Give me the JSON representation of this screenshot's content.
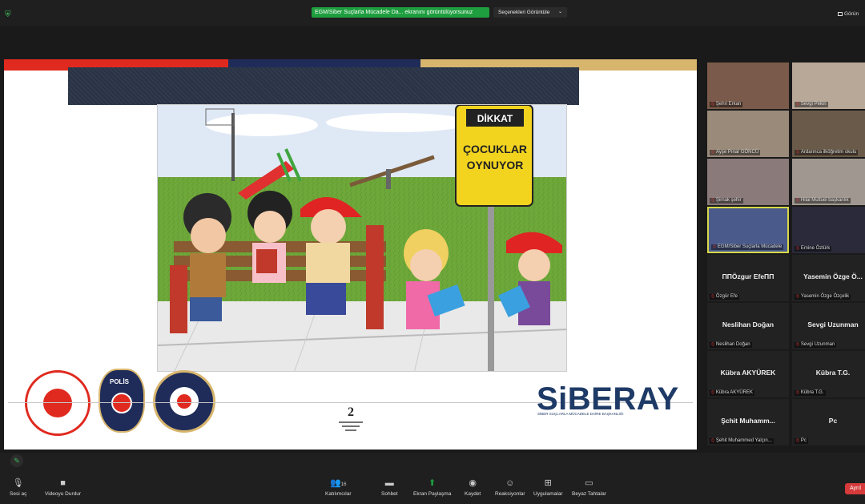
{
  "topbar": {
    "share_text": "EGM/Siber Suçlarla Mücadele Da... ekranını görüntülüyorsunuz",
    "view_options_label": "Seçenekleri Görüntüle",
    "fullscreen_label": "Görün"
  },
  "slide": {
    "page_number": "2",
    "brand": "SiBERAY",
    "brand_subtitle": "SİBER SUÇLARLA MÜCADELE DAİRE BAŞKANLIĞI",
    "sign_top": "DİKKAT",
    "sign_text": "ÇOCUKLAR OYNUYOR",
    "seal_polis": "POLİS"
  },
  "participants": [
    {
      "name": "Şehri Erkan",
      "label": ""
    },
    {
      "name": "Sevgi Pekin",
      "label": ""
    },
    {
      "name": "Ayşe Pınar GÖNCÜ",
      "label": ""
    },
    {
      "name": "Ardarınca ilköğretim okulu",
      "label": ""
    },
    {
      "name": "Şirnak şehir",
      "label": ""
    },
    {
      "name": "Hilal Mutluel başkanlık",
      "label": ""
    },
    {
      "name": "EGM/Siber Suçlarla Mücadele",
      "label": ""
    },
    {
      "name": "Emine Öztürk",
      "label": ""
    },
    {
      "name": "Özgür Efe",
      "label": "ΠΠÖzgur EfeΠΠ"
    },
    {
      "name": "Yasemin Özge Özçelik",
      "label": "Yasemin Özge Ö..."
    },
    {
      "name": "Neslihan Doğan",
      "label": "Neslihan Doğan"
    },
    {
      "name": "Sevgi Uzunman",
      "label": "Sevgi Uzunman"
    },
    {
      "name": "Kübra AKYÜREK",
      "label": "Kübra AKYÜREK"
    },
    {
      "name": "Kübra T.G.",
      "label": "Kübra T.G."
    },
    {
      "name": "Şehit Muhammed Yalçın...",
      "label": "Şchit Muhamm..."
    },
    {
      "name": "Pc",
      "label": "Pc"
    }
  ],
  "controls": {
    "mute": "Sesi aç",
    "video": "Videoyu Durdur",
    "participants": "Katılımcılar",
    "participants_count": "16",
    "chat": "Sohbet",
    "share": "Ekran Paylaşma",
    "record": "Kaydet",
    "reactions": "Reaksiyonlar",
    "apps": "Uygulamalar",
    "whiteboard": "Beyaz Tahtalar",
    "leave": "Ayrıl"
  },
  "colors": {
    "accent_green": "#1e9e3f",
    "leave_red": "#d63a3a",
    "brand_blue": "#1e3a66"
  }
}
